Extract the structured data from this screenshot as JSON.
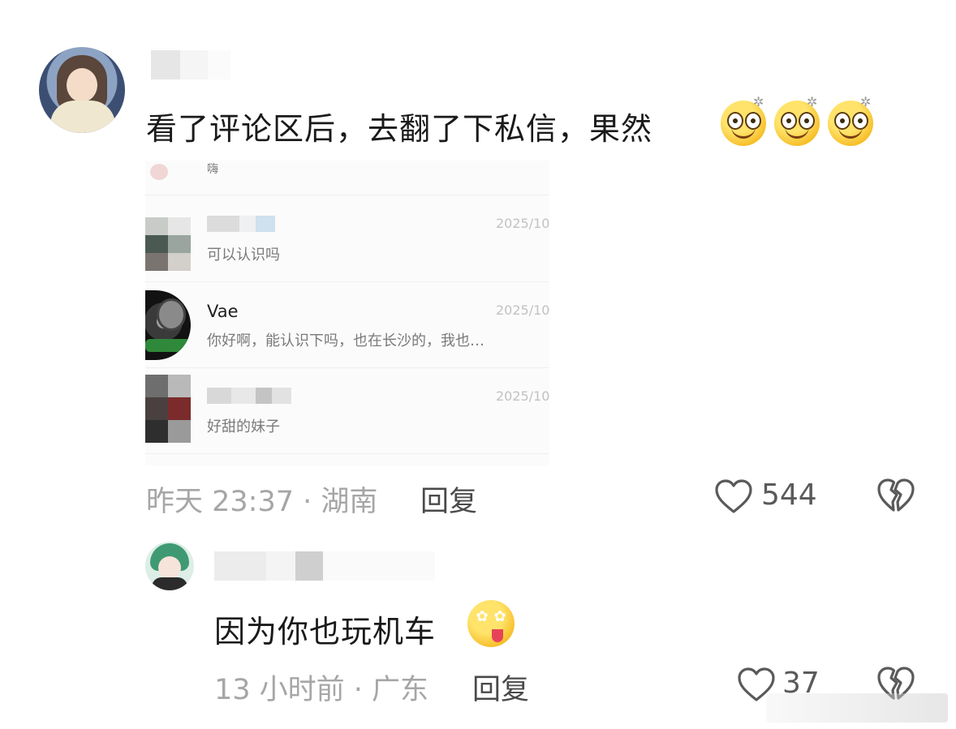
{
  "comment": {
    "text": "看了评论区后，去翻了下私信，果然",
    "emojis": [
      "dizzy-smile-emoji",
      "dizzy-smile-emoji",
      "dizzy-smile-emoji"
    ],
    "time": "昨天 23:37 · 湖南",
    "reply_label": "回复",
    "like_count": "544"
  },
  "dm_list": {
    "top_partial_msg": "嗨",
    "items": [
      {
        "name": "",
        "message": "可以认识吗",
        "date": "2025/10"
      },
      {
        "name": "Vae",
        "message": "你好啊，能认识下吗，也在长沙的，我也…",
        "date": "2025/10"
      },
      {
        "name": "",
        "message": "好甜的妹子",
        "date": "2025/10"
      }
    ]
  },
  "reply": {
    "text": "因为你也玩机车",
    "emoji": "flower-eyes-tongue-emoji",
    "time": "13 小时前 · 广东",
    "reply_label": "回复",
    "like_count": "37"
  },
  "colors": {
    "text_primary": "#1a1a1a",
    "text_meta": "#a6a6a6",
    "emoji_yellow": "#f5b81e"
  }
}
